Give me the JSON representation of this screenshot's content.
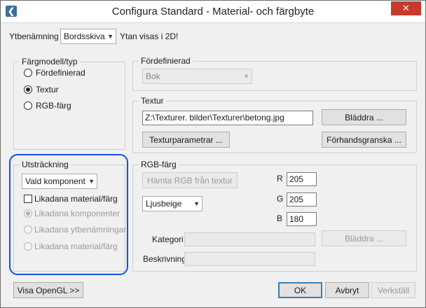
{
  "window": {
    "title": "Configura Standard - Material- och färgbyte",
    "close_glyph": "✕"
  },
  "surface": {
    "label": "Ytbenämning",
    "selected": "Bordsskiva",
    "note": "Ytan visas i 2D!"
  },
  "color_model": {
    "title": "Färgmodell/typ",
    "options": [
      {
        "label": "Fördefinierad",
        "checked": false
      },
      {
        "label": "Textur",
        "checked": true
      },
      {
        "label": "RGB-färg",
        "checked": false
      }
    ]
  },
  "predefined": {
    "title": "Fördefinierad",
    "selected": "Bok"
  },
  "texture": {
    "title": "Textur",
    "path": "Z:\\Texturer. bilder\\Texturer\\betong.jpg",
    "browse": "Bläddra ...",
    "params": "Texturparametrar ...",
    "preview": "Förhandsgranska ..."
  },
  "extent": {
    "title": "Utsträckning",
    "selected": "Vald komponent",
    "same_material_check": "Likadana material/färg",
    "options": [
      {
        "label": "Likadana komponenter",
        "checked": true
      },
      {
        "label": "Likadana ytbenämningar",
        "checked": false
      },
      {
        "label": "Likadana material/färg",
        "checked": false
      }
    ]
  },
  "rgb": {
    "title": "RGB-färg",
    "fetch": "Hämta RGB från textur",
    "r_label": "R",
    "r": "205",
    "g_label": "G",
    "g": "205",
    "b_label": "B",
    "b": "180",
    "color_name": "Ljusbeige",
    "category_label": "Kategori",
    "category_browse": "Bläddra ...",
    "description_label": "Beskrivning"
  },
  "footer": {
    "opengl": "Visa OpenGL >>",
    "ok": "OK",
    "cancel": "Avbryt",
    "apply": "Verkställ"
  }
}
